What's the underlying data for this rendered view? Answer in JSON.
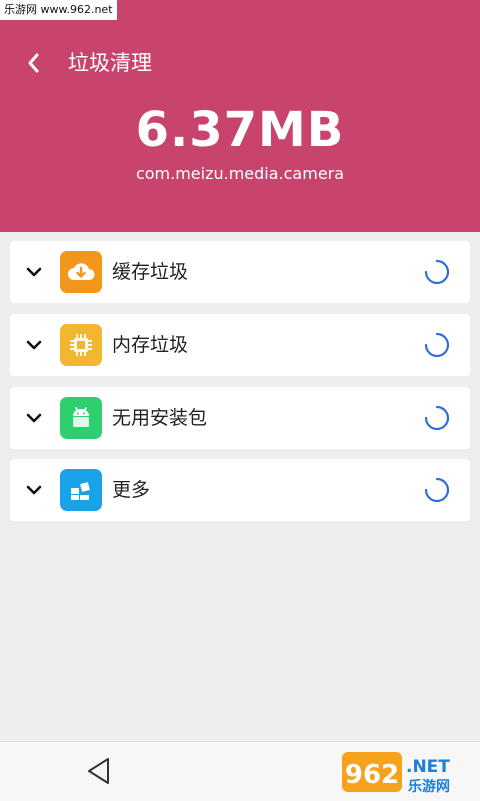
{
  "watermark": "乐游网 www.962.net",
  "header": {
    "title": "垃圾清理",
    "size": "6.37MB",
    "package": "com.meizu.media.camera",
    "bg_color": "#c9446d"
  },
  "items": [
    {
      "label": "缓存垃圾",
      "icon": "cloud-download-icon",
      "color": "#f5961c"
    },
    {
      "label": "内存垃圾",
      "icon": "chip-icon",
      "color": "#f2b630"
    },
    {
      "label": "无用安装包",
      "icon": "android-icon",
      "color": "#2ecf6f"
    },
    {
      "label": "更多",
      "icon": "grid-icon",
      "color": "#1aa2e8"
    }
  ],
  "spinner_color": "#2e6fd8",
  "logo": {
    "number": "962",
    "suffix": ".NET",
    "subtitle": "乐游网"
  }
}
